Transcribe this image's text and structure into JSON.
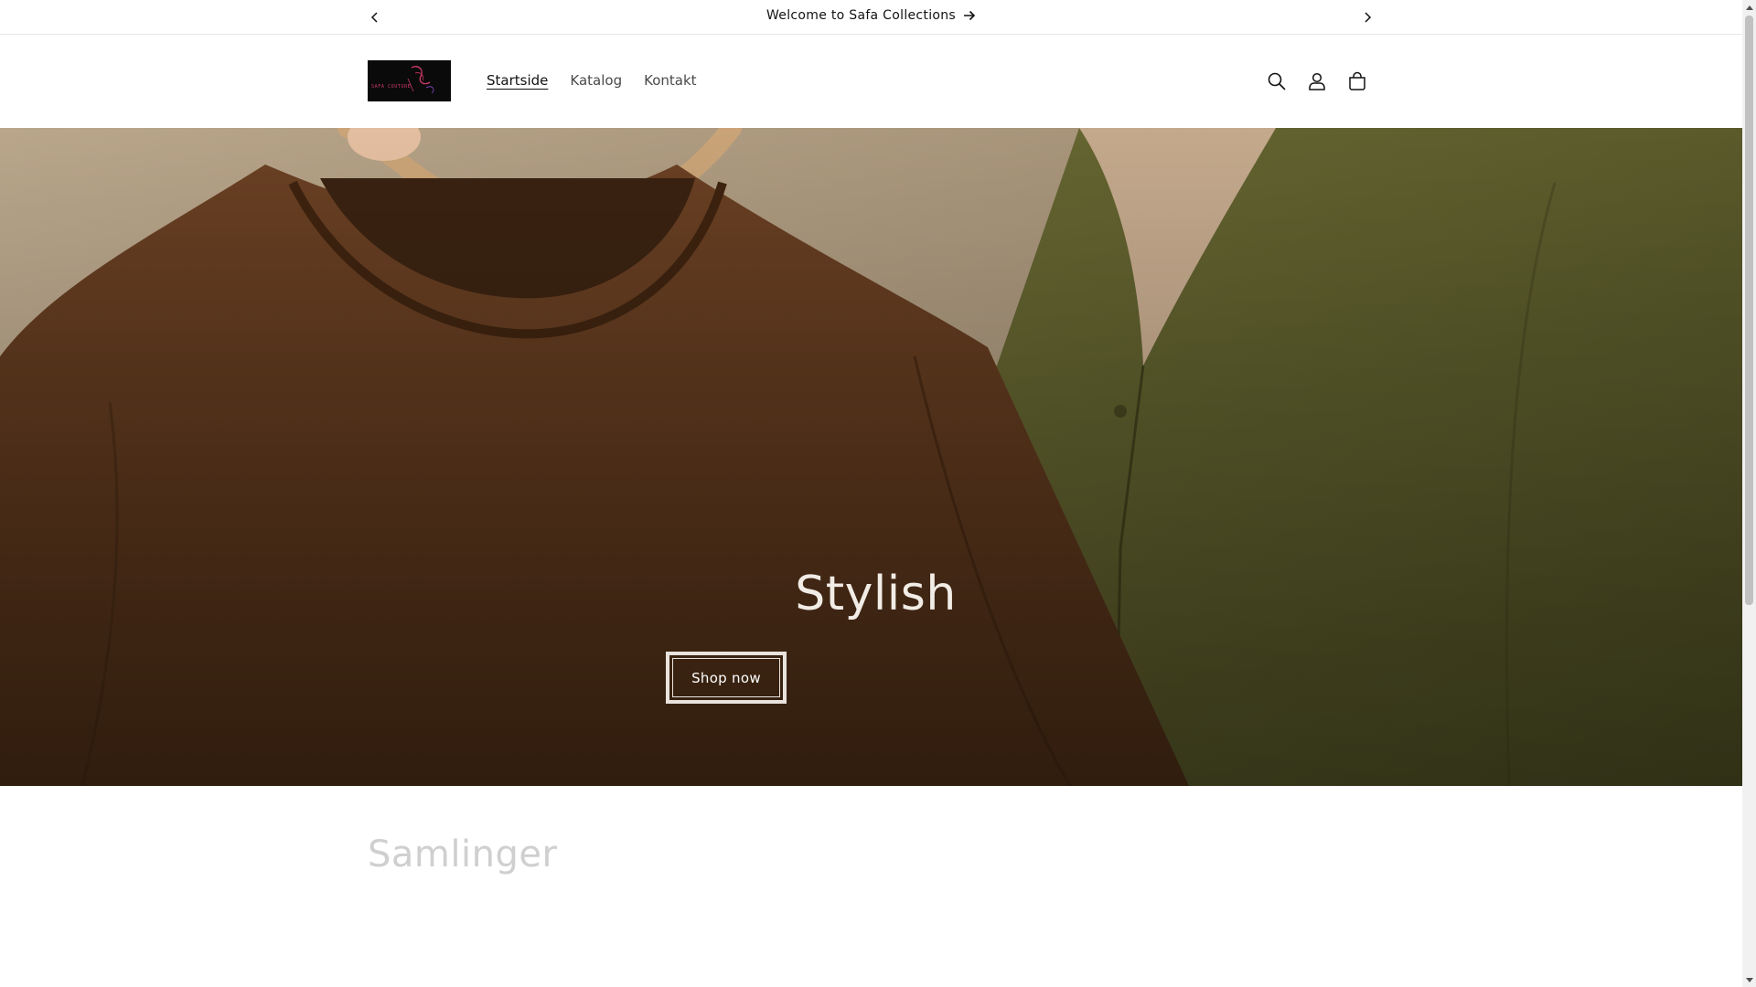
{
  "announcement": {
    "message": "Welcome to Safa Collections"
  },
  "header": {
    "logo_text": "SAFA COUTURE",
    "nav": [
      {
        "label": "Startside",
        "active": true
      },
      {
        "label": "Katalog",
        "active": false
      },
      {
        "label": "Kontakt",
        "active": false
      }
    ],
    "icons": [
      "search-icon",
      "account-icon",
      "cart-icon"
    ]
  },
  "hero": {
    "title": "Stylish",
    "button_label": "Shop now"
  },
  "collections": {
    "title": "Samlinger"
  },
  "colors": {
    "hero_tshirt": "#5d3a1e",
    "hero_cardigan": "#5b5b2c",
    "text": "#121212",
    "collections_title": "#cfcfcf"
  }
}
